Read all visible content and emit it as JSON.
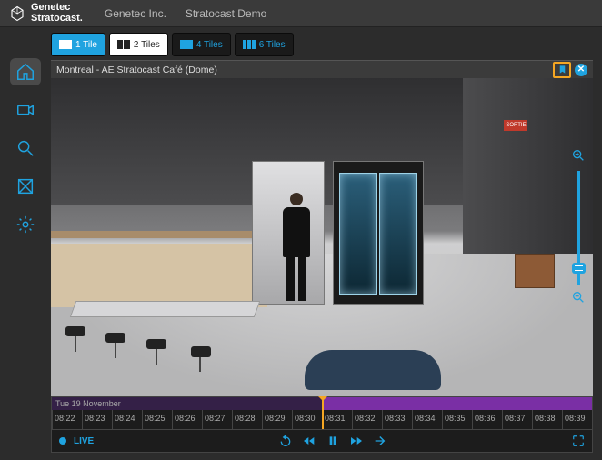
{
  "brand": {
    "line1": "Genetec",
    "line2": "Stratocast."
  },
  "crumbs": {
    "company": "Genetec Inc.",
    "project": "Stratocast Demo"
  },
  "tile_layouts": [
    {
      "id": "1",
      "label": "1 Tile",
      "grid": "g1",
      "state": "active"
    },
    {
      "id": "2",
      "label": "2 Tiles",
      "grid": "g2",
      "state": "white"
    },
    {
      "id": "4",
      "label": "4 Tiles",
      "grid": "g4",
      "state": ""
    },
    {
      "id": "6",
      "label": "6 Tiles",
      "grid": "g6",
      "state": ""
    }
  ],
  "camera": {
    "title": "Montreal - AE Stratocast Café (Dome)"
  },
  "timeline": {
    "date": "Tue 19 November",
    "ticks": [
      "08:22",
      "08:23",
      "08:24",
      "08:25",
      "08:26",
      "08:27",
      "08:28",
      "08:29",
      "08:30",
      "08:31",
      "08:32",
      "08:33",
      "08:34",
      "08:35",
      "08:36",
      "08:37",
      "08:38",
      "08:39"
    ],
    "playhead_index": 9,
    "recorded_from_index": 9
  },
  "playback": {
    "live_label": "LIVE"
  },
  "colors": {
    "accent": "#1fa3e0",
    "highlight": "#f5a623",
    "recorded": "#7a2fa5"
  }
}
